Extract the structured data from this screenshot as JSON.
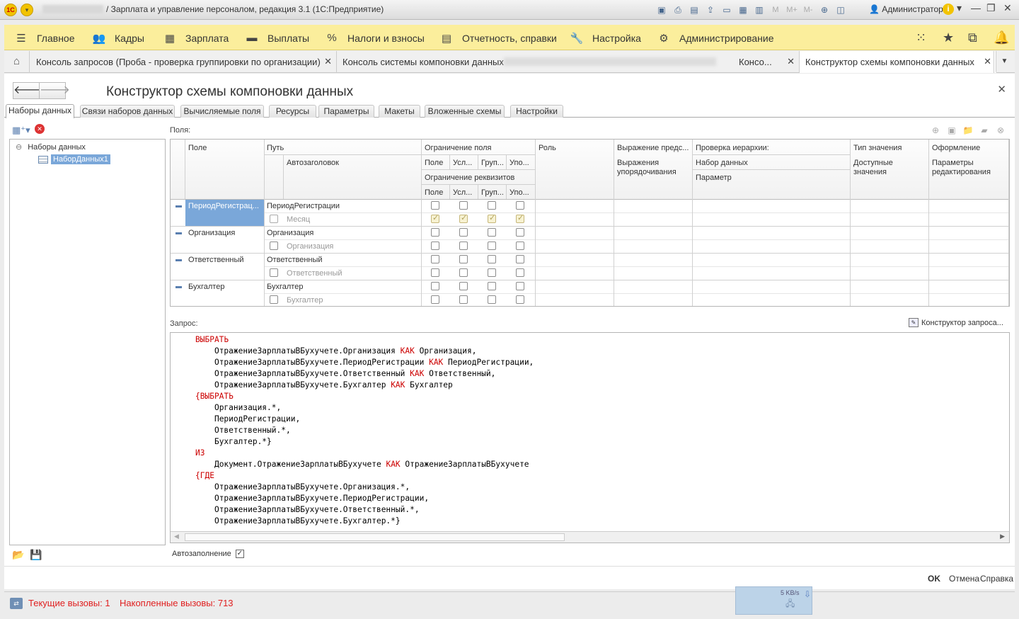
{
  "titlebar": {
    "title": "/ Зарплата и управление персоналом, редакция 3.1  (1С:Предприятие)",
    "user": "Администратор"
  },
  "mainmenu": {
    "items": [
      {
        "label": "Главное",
        "icon": "hamburger-icon"
      },
      {
        "label": "Кадры",
        "icon": "users-icon"
      },
      {
        "label": "Зарплата",
        "icon": "calculator-icon"
      },
      {
        "label": "Выплаты",
        "icon": "money-icon"
      },
      {
        "label": "Налоги и взносы",
        "icon": "percent-icon"
      },
      {
        "label": "Отчетность, справки",
        "icon": "report-icon"
      },
      {
        "label": "Настройка",
        "icon": "wrench-icon"
      },
      {
        "label": "Администрирование",
        "icon": "gear-icon"
      }
    ]
  },
  "tabs": {
    "items": [
      {
        "label": "Консоль запросов (Проба - проверка группировки по организации)"
      },
      {
        "label": "Консоль системы компоновки данных",
        "suffix": "Консо..."
      },
      {
        "label": "Конструктор схемы компоновки данных"
      }
    ]
  },
  "form": {
    "title": "Конструктор схемы компоновки данных",
    "page_tabs": [
      "Наборы данных",
      "Связи наборов данных",
      "Вычисляемые поля",
      "Ресурсы",
      "Параметры",
      "Макеты",
      "Вложенные схемы",
      "Настройки"
    ],
    "tree": {
      "root": "Наборы данных",
      "child": "НаборДанных1"
    },
    "fields_label": "Поля:",
    "columns": {
      "field": "Поле",
      "path": "Путь",
      "autotitle": "Автозаголовок",
      "field_restriction": "Ограничение поля",
      "attr_restriction": "Ограничение реквизитов",
      "r_field": "Поле",
      "r_cond": "Усл...",
      "r_group": "Груп...",
      "r_order": "Упо...",
      "role": "Роль",
      "expr_repr": "Выражение предс...",
      "expr_order": "Выражения упорядочивания",
      "hier_check": "Проверка иерархии:",
      "dataset": "Набор данных",
      "param": "Параметр",
      "value_type": "Тип значения",
      "avail_values": "Доступные значения",
      "appearance": "Оформление",
      "edit_params": "Параметры редактирования"
    },
    "rows": [
      {
        "field": "ПериодРегистрац...",
        "path": "ПериодРегистрации",
        "title": "Месяц",
        "checked2": true
      },
      {
        "field": "Организация",
        "path": "Организация",
        "title": "Организация",
        "checked2": false
      },
      {
        "field": "Ответственный",
        "path": "Ответственный",
        "title": "Ответственный",
        "checked2": false
      },
      {
        "field": "Бухгалтер",
        "path": "Бухгалтер",
        "title": "Бухгалтер",
        "checked2": false
      }
    ],
    "query_label": "Запрос:",
    "query_constructor": "Конструктор запроса...",
    "query_lines": [
      {
        "k": "ВЫБРАТЬ",
        "indent": 0
      },
      {
        "t": "ОтражениеЗарплатыВБухучете.Организация КАК Организация,",
        "indent": 1
      },
      {
        "t": "ОтражениеЗарплатыВБухучете.ПериодРегистрации КАК ПериодРегистрации,",
        "indent": 1
      },
      {
        "t": "ОтражениеЗарплатыВБухучете.Ответственный КАК Ответственный,",
        "indent": 1
      },
      {
        "t": "ОтражениеЗарплатыВБухучете.Бухгалтер КАК Бухгалтер",
        "indent": 1
      },
      {
        "k": "{ВЫБРАТЬ",
        "indent": 0
      },
      {
        "t": "Организация.*,",
        "indent": 1
      },
      {
        "t": "ПериодРегистрации,",
        "indent": 1
      },
      {
        "t": "Ответственный.*,",
        "indent": 1
      },
      {
        "t": "Бухгалтер.*}",
        "indent": 1
      },
      {
        "k": "ИЗ",
        "indent": 0
      },
      {
        "t": "Документ.ОтражениеЗарплатыВБухучете КАК ОтражениеЗарплатыВБухучете",
        "indent": 1
      },
      {
        "k": "{ГДЕ",
        "indent": 0
      },
      {
        "t": "ОтражениеЗарплатыВБухучете.Организация.*,",
        "indent": 1
      },
      {
        "t": "ОтражениеЗарплатыВБухучете.ПериодРегистрации,",
        "indent": 1
      },
      {
        "t": "ОтражениеЗарплатыВБухучете.Ответственный.*,",
        "indent": 1
      },
      {
        "t": "ОтражениеЗарплатыВБухучете.Бухгалтер.*}",
        "indent": 1
      }
    ],
    "autofill_label": "Автозаполнение",
    "autofill_checked": true,
    "buttons": {
      "ok": "OK",
      "cancel": "Отмена",
      "help": "Справка"
    }
  },
  "status": {
    "current_calls": "Текущие вызовы: 1",
    "accumulated_calls": "Накопленные вызовы: 713",
    "net_speed": "5 KB/s"
  },
  "colors": {
    "menu_bg": "#fbee9c",
    "selection": "#7aa7d9",
    "status_text": "#e02020",
    "keyword": "#cc0000"
  }
}
